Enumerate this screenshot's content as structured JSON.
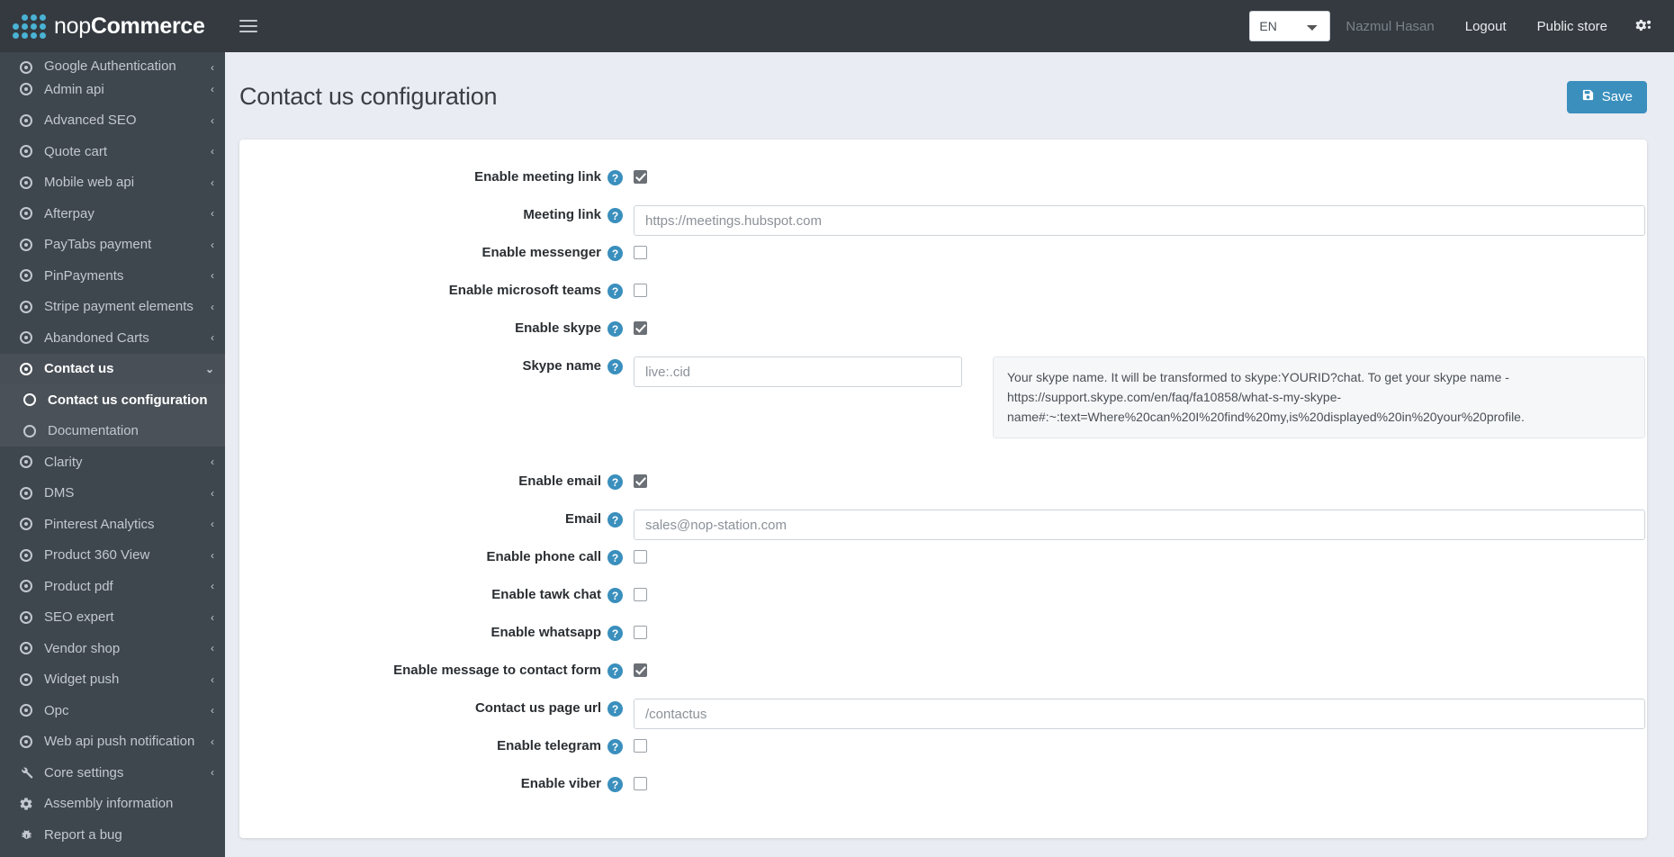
{
  "brand": {
    "light": "nop",
    "bold": "Commerce",
    "logo_icon": "nopcommerce-dots-logo"
  },
  "topbar": {
    "menu_toggle_icon": "hamburger-menu-icon",
    "language": {
      "selected": "EN",
      "options": [
        "EN"
      ]
    },
    "user_name": "Nazmul Hasan",
    "logout_label": "Logout",
    "public_store_label": "Public store",
    "settings_icon": "gears-icon"
  },
  "sidebar": {
    "items": [
      {
        "label": "Google Authentication",
        "icon": "dot-circle-icon",
        "chevron": "‹",
        "state": "clipped"
      },
      {
        "label": "Admin api",
        "icon": "dot-circle-icon",
        "chevron": "‹"
      },
      {
        "label": "Advanced SEO",
        "icon": "dot-circle-icon",
        "chevron": "‹"
      },
      {
        "label": "Quote cart",
        "icon": "dot-circle-icon",
        "chevron": "‹"
      },
      {
        "label": "Mobile web api",
        "icon": "dot-circle-icon",
        "chevron": "‹"
      },
      {
        "label": "Afterpay",
        "icon": "dot-circle-icon",
        "chevron": "‹"
      },
      {
        "label": "PayTabs payment",
        "icon": "dot-circle-icon",
        "chevron": "‹"
      },
      {
        "label": "PinPayments",
        "icon": "dot-circle-icon",
        "chevron": "‹"
      },
      {
        "label": "Stripe payment elements",
        "icon": "dot-circle-icon",
        "chevron": "‹"
      },
      {
        "label": "Abandoned Carts",
        "icon": "dot-circle-icon",
        "chevron": "‹"
      },
      {
        "label": "Contact us",
        "icon": "dot-circle-icon",
        "chevron": "⌄",
        "active": true
      },
      {
        "label": "Clarity",
        "icon": "dot-circle-icon",
        "chevron": "‹"
      },
      {
        "label": "DMS",
        "icon": "dot-circle-icon",
        "chevron": "‹"
      },
      {
        "label": "Pinterest Analytics",
        "icon": "dot-circle-icon",
        "chevron": "‹"
      },
      {
        "label": "Product 360 View",
        "icon": "dot-circle-icon",
        "chevron": "‹"
      },
      {
        "label": "Product pdf",
        "icon": "dot-circle-icon",
        "chevron": "‹"
      },
      {
        "label": "SEO expert",
        "icon": "dot-circle-icon",
        "chevron": "‹"
      },
      {
        "label": "Vendor shop",
        "icon": "dot-circle-icon",
        "chevron": "‹"
      },
      {
        "label": "Widget push",
        "icon": "dot-circle-icon",
        "chevron": "‹"
      },
      {
        "label": "Opc",
        "icon": "dot-circle-icon",
        "chevron": "‹"
      },
      {
        "label": "Web api push notification",
        "icon": "dot-circle-icon",
        "chevron": "‹"
      },
      {
        "label": "Core settings",
        "icon": "wrench-icon",
        "chevron": "‹"
      },
      {
        "label": "Assembly information",
        "icon": "gear-icon",
        "chevron": ""
      },
      {
        "label": "Report a bug",
        "icon": "bug-icon",
        "chevron": ""
      }
    ],
    "submenu": [
      {
        "label": "Contact us configuration",
        "icon": "circle-icon",
        "current": true
      },
      {
        "label": "Documentation",
        "icon": "circle-icon",
        "current": false
      }
    ]
  },
  "page": {
    "title": "Contact us configuration",
    "save_label": "Save",
    "save_icon": "floppy-save-icon"
  },
  "form": {
    "enable_meeting_link": {
      "label": "Enable meeting link",
      "checked": true
    },
    "meeting_link": {
      "label": "Meeting link",
      "value": "",
      "placeholder": "https://meetings.hubspot.com"
    },
    "enable_messenger": {
      "label": "Enable messenger",
      "checked": false
    },
    "enable_microsoft_teams": {
      "label": "Enable microsoft teams",
      "checked": false
    },
    "enable_skype": {
      "label": "Enable skype",
      "checked": true
    },
    "skype_name": {
      "label": "Skype name",
      "value": "",
      "placeholder": "live:.cid",
      "hint": "Your skype name. It will be transformed to skype:YOURID?chat. To get your skype name - https://support.skype.com/en/faq/fa10858/what-s-my-skype-name#:~:text=Where%20can%20I%20find%20my,is%20displayed%20in%20your%20profile."
    },
    "enable_email": {
      "label": "Enable email",
      "checked": true
    },
    "email": {
      "label": "Email",
      "value": "",
      "placeholder": "sales@nop-station.com"
    },
    "enable_phone_call": {
      "label": "Enable phone call",
      "checked": false
    },
    "enable_tawk_chat": {
      "label": "Enable tawk chat",
      "checked": false
    },
    "enable_whatsapp": {
      "label": "Enable whatsapp",
      "checked": false
    },
    "enable_message_to_contact_form": {
      "label": "Enable message to contact form",
      "checked": true
    },
    "contact_us_page_url": {
      "label": "Contact us page url",
      "value": "",
      "placeholder": "/contactus"
    },
    "enable_telegram": {
      "label": "Enable telegram",
      "checked": false
    },
    "enable_viber": {
      "label": "Enable viber",
      "checked": false
    }
  },
  "colors": {
    "accent": "#3a8fbd",
    "sidebar": "#3f474e",
    "topbar": "#343a40",
    "page_bg": "#e9ecf2"
  }
}
